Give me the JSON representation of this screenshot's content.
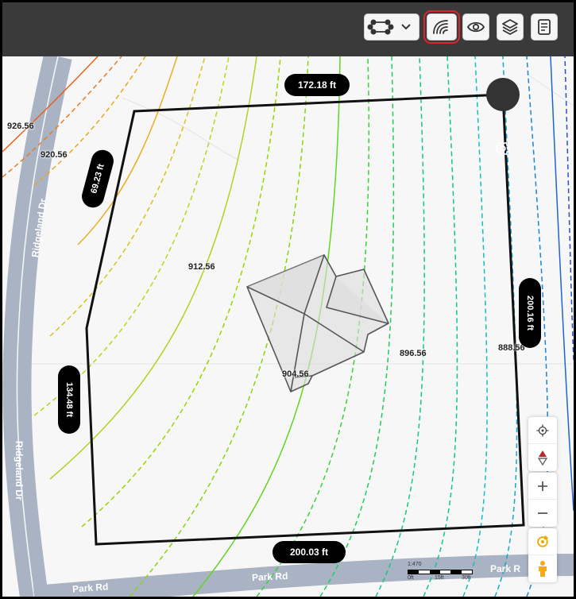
{
  "toolbar": {
    "buttons": [
      {
        "name": "shape-tool-dropdown",
        "icon": "polygon-nodes-icon"
      },
      {
        "name": "contours-button",
        "icon": "contour-lines-icon",
        "active": true
      },
      {
        "name": "visibility-button",
        "icon": "eye-icon"
      },
      {
        "name": "layers-button",
        "icon": "layers-icon"
      },
      {
        "name": "report-button",
        "icon": "document-icon"
      }
    ],
    "active_outline_color": "#d9262d"
  },
  "map": {
    "streets": [
      "Ridgeland Dr",
      "Ridgeland Dr",
      "Park Rd",
      "Park Rd"
    ],
    "elevation_labels": [
      "926.56",
      "920.56",
      "912.56",
      "904.56",
      "896.56",
      "888.56"
    ],
    "dimensions": [
      "172.18 ft",
      "69.23 ft",
      "134.48 ft",
      "200.16 ft",
      "200.03 ft"
    ],
    "settings_icon": "gear-icon"
  },
  "scale": {
    "ratio": "1:470",
    "labels": [
      "0ft",
      "15ft",
      "30ft"
    ]
  },
  "controls": {
    "items": [
      "locate-icon",
      "compass-icon",
      "zoom-in-icon",
      "zoom-out-icon",
      "rotate-icon",
      "pegman-icon"
    ]
  },
  "colors": {
    "contour_high": "#e8621c",
    "contour_mid": "#8fd400",
    "contour_low": "#1e64d2",
    "road": "#a9b3c4",
    "boundary": "#111111"
  }
}
